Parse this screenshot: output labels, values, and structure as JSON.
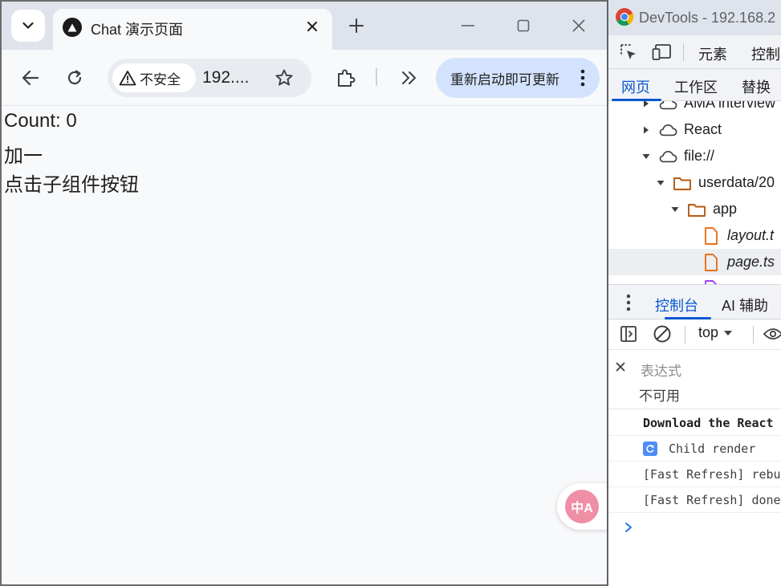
{
  "browser": {
    "tab": {
      "title": "Chat 演示页面"
    },
    "toolbar": {
      "security_label": "不安全",
      "url": "192....",
      "update_label": "重新启动即可更新"
    }
  },
  "page": {
    "lines": [
      "Count: 0",
      "加一",
      "点击子组件按钮"
    ],
    "translate_icon_text": "中A"
  },
  "devtools": {
    "title": "DevTools - 192.168.2",
    "main_tabs": [
      "元素",
      "控制"
    ],
    "sub_tabs": [
      "网页",
      "工作区",
      "替换"
    ],
    "file_tree": [
      {
        "label": "AMA interview",
        "icon": "cloud-icon",
        "arrow": "collapsed"
      },
      {
        "label": "React",
        "icon": "cloud-icon",
        "arrow": "collapsed"
      },
      {
        "label": "file://",
        "icon": "cloud-icon",
        "arrow": "expanded"
      },
      {
        "label": "userdata/20",
        "icon": "folder-icon",
        "arrow": "expanded"
      },
      {
        "label": "app",
        "icon": "folder-icon",
        "arrow": "expanded"
      },
      {
        "label": "layout.t",
        "icon": "file-icon",
        "arrow": "none"
      },
      {
        "label": "page.ts",
        "icon": "file-icon",
        "arrow": "none"
      }
    ],
    "drawer_tabs": [
      "控制台",
      "AI 辅助"
    ],
    "console": {
      "context": "top",
      "live_expression_placeholder": "表达式",
      "live_expression_value": "不可用",
      "log": [
        "Download the React",
        "Child render",
        "[Fast Refresh] rebu",
        "[Fast Refresh] done"
      ]
    }
  },
  "colors": {
    "accent": "#0b57d0",
    "tab_strip": "#dfe3eb",
    "update_chip": "#d3e3fd",
    "folder": "#b65a12",
    "file": "#e8711a",
    "translate_fab": "#ef8fa6"
  }
}
